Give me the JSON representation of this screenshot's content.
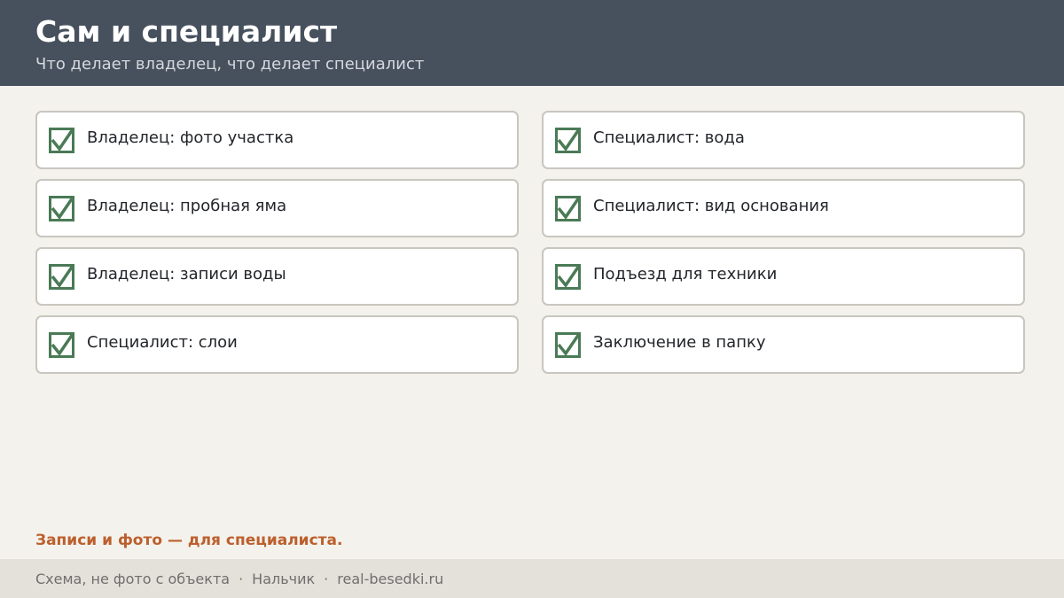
{
  "header": {
    "title": "Сам и специалист",
    "subtitle": "Что делает владелец, что делает специалист"
  },
  "checklist": {
    "items": [
      {
        "label": "Владелец: фото участка",
        "checked": true
      },
      {
        "label": "Специалист: вода",
        "checked": true
      },
      {
        "label": "Владелец: пробная яма",
        "checked": true
      },
      {
        "label": "Специалист: вид основания",
        "checked": true
      },
      {
        "label": "Владелец: записи воды",
        "checked": true
      },
      {
        "label": "Подъезд для техники",
        "checked": true
      },
      {
        "label": "Специалист: слои",
        "checked": true
      },
      {
        "label": "Заключение в папку",
        "checked": true
      }
    ],
    "icon": "checkbox-checked-icon"
  },
  "note": "Записи и фото — для специалиста.",
  "footer": {
    "caption": "Схема, не фото с объекта",
    "separator": "·",
    "city": "Нальчик",
    "site": "real-besedki.ru"
  },
  "colors": {
    "header_bg": "#47505d",
    "page_bg": "#f4f2ed",
    "check_green": "#4a7a56",
    "accent_orange": "#bc5f2c",
    "footer_bg": "#e4e1da"
  }
}
